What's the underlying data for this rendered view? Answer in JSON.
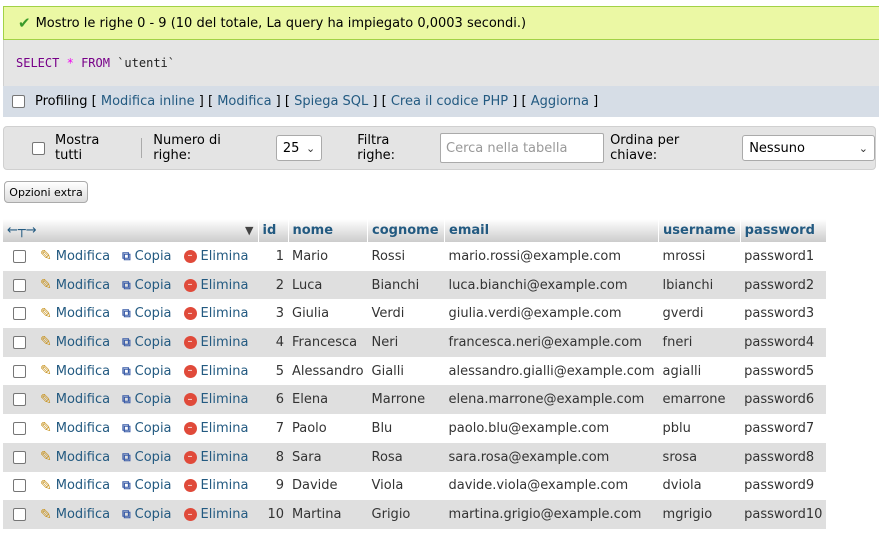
{
  "message": {
    "icon": "check-icon",
    "text": "Mostro le righe 0 - 9 (10 del totale, La query ha impiegato 0,0003 secondi.)"
  },
  "sql": {
    "select": "SELECT",
    "star": "*",
    "from": "FROM",
    "table": "`utenti`"
  },
  "tools": {
    "profiling": "Profiling",
    "links": [
      "Modifica inline",
      "Modifica",
      "Spiega SQL",
      "Crea il codice PHP",
      "Aggiorna"
    ]
  },
  "nav": {
    "show_all": "Mostra tutti",
    "rows_label": "Numero di righe:",
    "rows_value": "25",
    "filter_label": "Filtra righe:",
    "filter_placeholder": "Cerca nella tabella",
    "sort_label": "Ordina per chiave:",
    "sort_value": "Nessuno"
  },
  "extra_button": "Opzioni extra",
  "table": {
    "columns": [
      "id",
      "nome",
      "cognome",
      "email",
      "username",
      "password"
    ],
    "actions": {
      "edit": "Modifica",
      "copy": "Copia",
      "delete": "Elimina"
    },
    "rows": [
      [
        "1",
        "Mario",
        "Rossi",
        "mario.rossi@example.com",
        "mrossi",
        "password1"
      ],
      [
        "2",
        "Luca",
        "Bianchi",
        "luca.bianchi@example.com",
        "lbianchi",
        "password2"
      ],
      [
        "3",
        "Giulia",
        "Verdi",
        "giulia.verdi@example.com",
        "gverdi",
        "password3"
      ],
      [
        "4",
        "Francesca",
        "Neri",
        "francesca.neri@example.com",
        "fneri",
        "password4"
      ],
      [
        "5",
        "Alessandro",
        "Gialli",
        "alessandro.gialli@example.com",
        "agialli",
        "password5"
      ],
      [
        "6",
        "Elena",
        "Marrone",
        "elena.marrone@example.com",
        "emarrone",
        "password6"
      ],
      [
        "7",
        "Paolo",
        "Blu",
        "paolo.blu@example.com",
        "pblu",
        "password7"
      ],
      [
        "8",
        "Sara",
        "Rosa",
        "sara.rosa@example.com",
        "srosa",
        "password8"
      ],
      [
        "9",
        "Davide",
        "Viola",
        "davide.viola@example.com",
        "dviola",
        "password9"
      ],
      [
        "10",
        "Martina",
        "Grigio",
        "martina.grigio@example.com",
        "mgrigio",
        "password10"
      ]
    ]
  }
}
